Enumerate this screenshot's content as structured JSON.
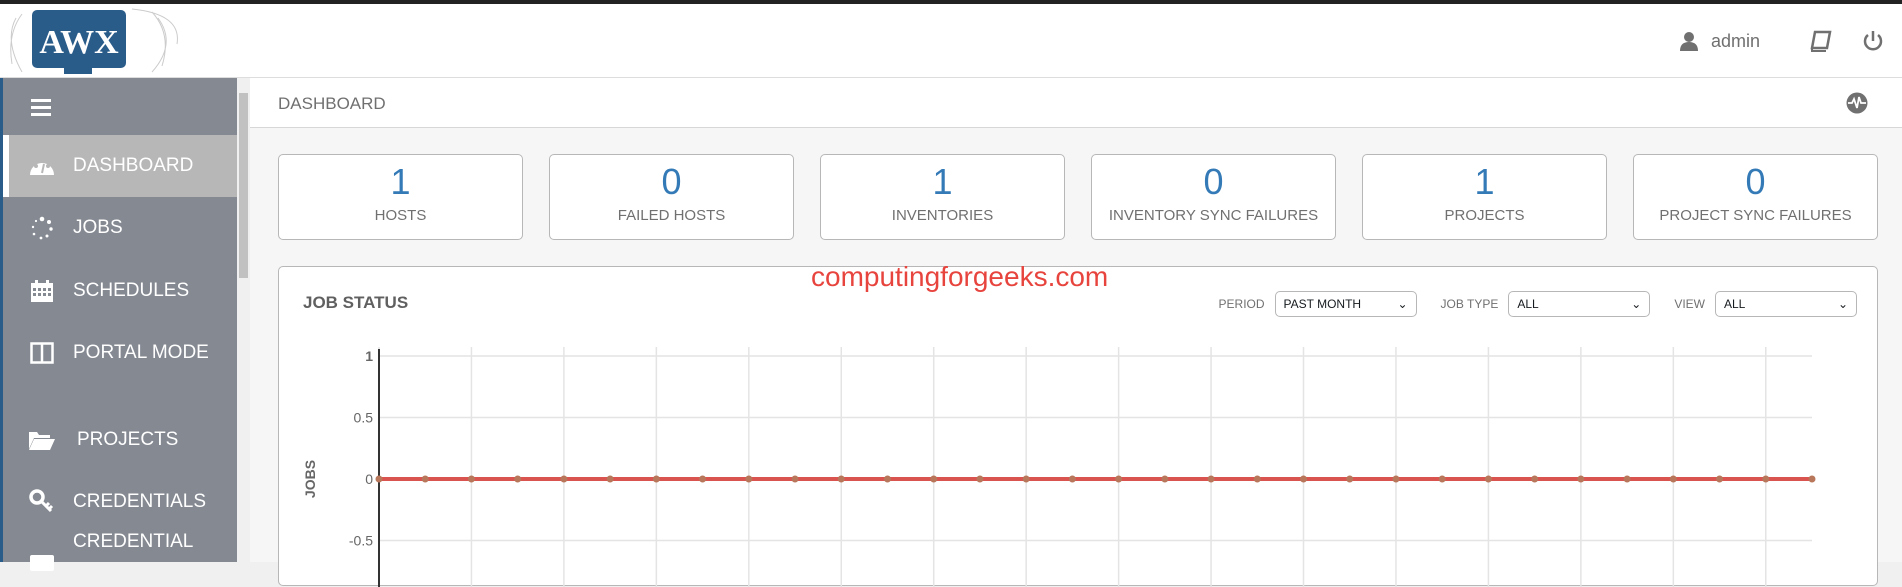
{
  "header": {
    "logo_text": "AWX",
    "user": "admin",
    "icons": [
      "user-icon",
      "book-icon",
      "power-icon"
    ]
  },
  "sidebar": {
    "items": [
      {
        "label": "DASHBOARD",
        "icon": "dashboard-icon",
        "active": true
      },
      {
        "label": "JOBS",
        "icon": "spinner-icon"
      },
      {
        "label": "SCHEDULES",
        "icon": "calendar-icon"
      },
      {
        "label": "PORTAL MODE",
        "icon": "columns-icon"
      },
      {
        "label": "PROJECTS",
        "icon": "folder-icon"
      },
      {
        "label": "CREDENTIALS",
        "icon": "key-icon"
      },
      {
        "label": "CREDENTIAL",
        "icon": "card-icon"
      }
    ]
  },
  "page": {
    "title": "DASHBOARD",
    "activity_icon": "activity-stream-icon"
  },
  "counts": [
    {
      "value": "1",
      "label": "HOSTS"
    },
    {
      "value": "0",
      "label": "FAILED HOSTS"
    },
    {
      "value": "1",
      "label": "INVENTORIES"
    },
    {
      "value": "0",
      "label": "INVENTORY SYNC FAILURES"
    },
    {
      "value": "1",
      "label": "PROJECTS"
    },
    {
      "value": "0",
      "label": "PROJECT SYNC FAILURES"
    }
  ],
  "job_status": {
    "title": "JOB STATUS",
    "watermark": "computingforgeeks.com",
    "filters": [
      {
        "label": "PERIOD",
        "value": "PAST MONTH"
      },
      {
        "label": "JOB TYPE",
        "value": "ALL"
      },
      {
        "label": "VIEW",
        "value": "ALL"
      }
    ]
  },
  "chart_data": {
    "type": "line",
    "ylabel": "JOBS",
    "yticks": [
      "1",
      "0.5",
      "0",
      "-0.5"
    ],
    "ylim": [
      -0.6,
      1
    ],
    "series": [
      {
        "name": "jobs",
        "color": "#d9534f",
        "values": [
          0,
          0,
          0,
          0,
          0,
          0,
          0,
          0,
          0,
          0,
          0,
          0,
          0,
          0,
          0,
          0,
          0,
          0,
          0,
          0,
          0,
          0,
          0,
          0,
          0,
          0,
          0,
          0,
          0,
          0,
          0,
          0
        ]
      }
    ]
  }
}
